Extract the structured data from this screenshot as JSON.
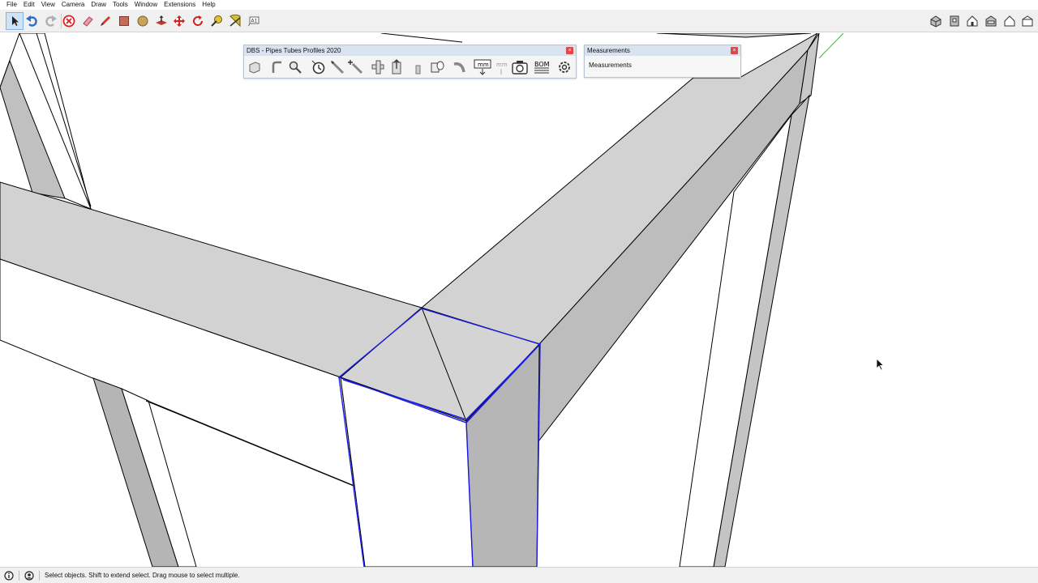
{
  "menu": {
    "items": [
      "File",
      "Edit",
      "View",
      "Camera",
      "Draw",
      "Tools",
      "Window",
      "Extensions",
      "Help"
    ]
  },
  "toolbar": {
    "left_icons": [
      "select-icon",
      "undo-icon",
      "redo-icon",
      "delete-icon",
      "eraser-icon",
      "pencil-icon",
      "rectangle-icon",
      "circle-icon",
      "push-pull-icon",
      "move-icon",
      "rotate-icon",
      "tape-measure-icon",
      "protractor-icon",
      "text-icon"
    ],
    "right_icons": [
      "iso-view-icon",
      "top-view-icon",
      "front-view-icon",
      "right-view-icon",
      "back-view-icon",
      "left-view-icon"
    ]
  },
  "pipes_panel": {
    "title": "DBS - Pipes Tubes Profiles 2020",
    "icons": [
      "profile-box-icon",
      "profile-bend-icon",
      "search-pipe-icon",
      "pipe-along-path-icon",
      "rotate-profile-icon",
      "trim-icon",
      "extend-icon",
      "tee-joint-icon",
      "flange-icon",
      "cap-icon",
      "elbow-icon",
      "unit-mm-icon",
      "unit-mm-inactive-icon",
      "camera-icon",
      "bom-icon",
      "settings-icon"
    ],
    "labels": {
      "mm": "mm",
      "mm2": "mm",
      "bom": "BOM"
    }
  },
  "measurements_panel": {
    "title": "Measurements",
    "field_label": "Measurements"
  },
  "status": {
    "text": "Select objects. Shift to extend select. Drag mouse to select multiple."
  },
  "colors": {
    "selection": "#1a1ae6",
    "face_light": "#d4d4d4",
    "face_mid": "#bfbfbf",
    "face_dark": "#b0b0b0",
    "edge": "#000000",
    "axis_green": "#3cb93c"
  }
}
